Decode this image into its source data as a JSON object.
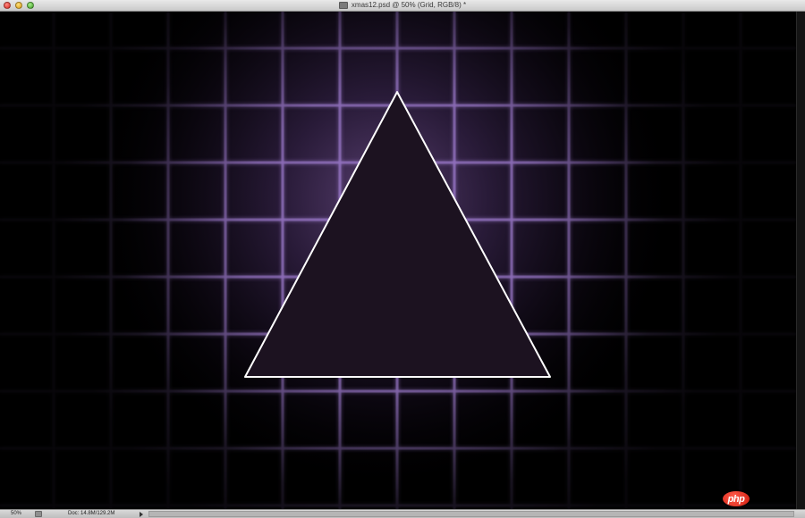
{
  "window": {
    "title": "xmas12.psd @ 50% (Grid, RGB/8) *"
  },
  "controls": {
    "close": "close-button",
    "minimize": "minimize-button",
    "zoom": "zoom-button"
  },
  "canvas": {
    "background": "#000000",
    "grid_color": "#9a78c8",
    "glow_color": "#7a5a9a",
    "triangle_fill": "#1c1220",
    "triangle_stroke": "#ffffff"
  },
  "status": {
    "zoom": "50%",
    "doc_info": "Doc: 14.8M/129.2M"
  },
  "watermark": {
    "text": "php",
    "color": "#e0281a"
  }
}
